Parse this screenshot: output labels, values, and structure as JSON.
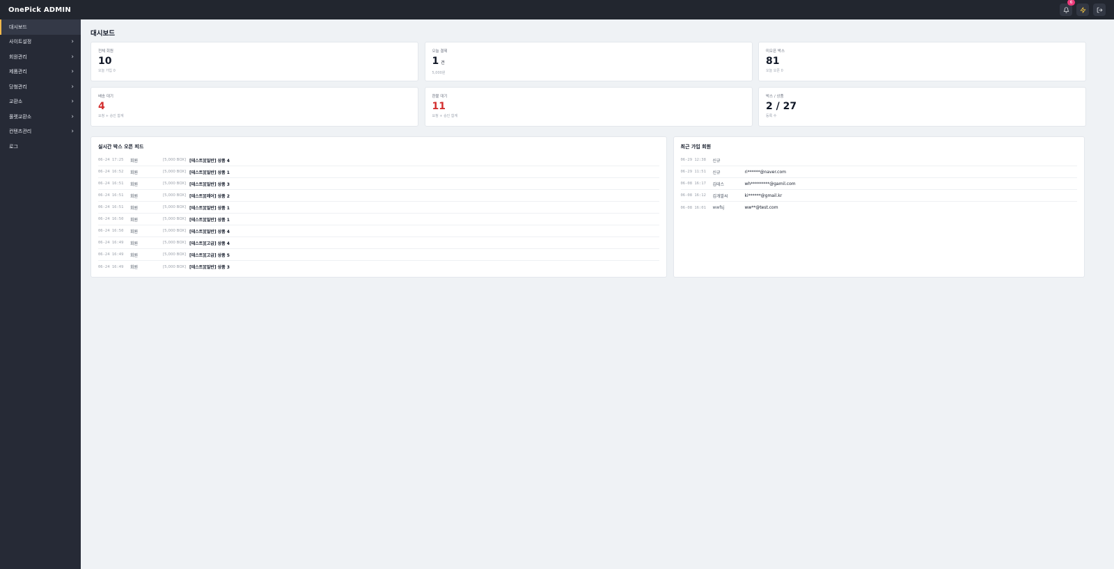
{
  "header": {
    "brand": "OnePick ADMIN",
    "notification_count": "6",
    "icons": [
      "bell-icon",
      "bolt-icon",
      "logout-icon"
    ]
  },
  "sidebar": {
    "items": [
      {
        "label": "대시보드",
        "active": true,
        "has_children": false
      },
      {
        "label": "사이트설정",
        "active": false,
        "has_children": true
      },
      {
        "label": "회원관리",
        "active": false,
        "has_children": true
      },
      {
        "label": "제품관리",
        "active": false,
        "has_children": true
      },
      {
        "label": "당첨관리",
        "active": false,
        "has_children": true
      },
      {
        "label": "교환소",
        "active": false,
        "has_children": true
      },
      {
        "label": "풀렛교환소",
        "active": false,
        "has_children": true
      },
      {
        "label": "컨텐츠관리",
        "active": false,
        "has_children": true
      },
      {
        "label": "로그",
        "active": false,
        "has_children": false
      }
    ]
  },
  "page": {
    "title": "대시보드"
  },
  "stats": [
    {
      "label": "전체 회원",
      "value": "10",
      "unit": "",
      "sub": "오늘 가입 0",
      "highlight": false
    },
    {
      "label": "오늘 결제",
      "value": "1",
      "unit": "건",
      "sub": "5,000원",
      "highlight": false
    },
    {
      "label": "미오픈 박스",
      "value": "81",
      "unit": "",
      "sub": "오늘 오픈 0",
      "highlight": false
    },
    {
      "label": "배송 대기",
      "value": "4",
      "unit": "",
      "sub": "요청 + 승인 합계",
      "highlight": true
    },
    {
      "label": "환불 대기",
      "value": "11",
      "unit": "",
      "sub": "요청 + 승인 합계",
      "highlight": true
    },
    {
      "label": "박스 / 상품",
      "value": "2 / 27",
      "unit": "",
      "sub": "등록 수",
      "highlight": false
    }
  ],
  "feed": {
    "title": "실시간 박스 오픈 피드",
    "rows": [
      {
        "time": "06-24 17:25",
        "who": "회원",
        "box": "[5,000 BOX]",
        "item": "[테스트][일반] 상품 4"
      },
      {
        "time": "06-24 16:52",
        "who": "회원",
        "box": "[5,000 BOX]",
        "item": "[테스트][일반] 상품 1"
      },
      {
        "time": "06-24 16:51",
        "who": "회원",
        "box": "[5,000 BOX]",
        "item": "[테스트][일반] 상품 3"
      },
      {
        "time": "06-24 16:51",
        "who": "회원",
        "box": "[5,000 BOX]",
        "item": "[테스트][레어] 상품 2"
      },
      {
        "time": "06-24 16:51",
        "who": "회원",
        "box": "[5,000 BOX]",
        "item": "[테스트][일반] 상품 1"
      },
      {
        "time": "06-24 16:50",
        "who": "회원",
        "box": "[5,000 BOX]",
        "item": "[테스트][일반] 상품 1"
      },
      {
        "time": "06-24 16:50",
        "who": "회원",
        "box": "[5,000 BOX]",
        "item": "[테스트][일반] 상품 4"
      },
      {
        "time": "06-24 16:49",
        "who": "회원",
        "box": "[5,000 BOX]",
        "item": "[테스트][고급] 상품 4"
      },
      {
        "time": "06-24 16:49",
        "who": "회원",
        "box": "[5,000 BOX]",
        "item": "[테스트][고급] 상품 5"
      },
      {
        "time": "06-24 16:49",
        "who": "회원",
        "box": "[5,000 BOX]",
        "item": "[테스트][일반] 상품 3"
      }
    ]
  },
  "members": {
    "title": "최근 가입 회원",
    "rows": [
      {
        "time": "06-29 12:38",
        "name": "신규",
        "email": ""
      },
      {
        "time": "06-29 11:51",
        "name": "신규",
        "email": "ri******@naver.com"
      },
      {
        "time": "06-08 16:17",
        "name": "김테스",
        "email": "wh*********@gamil.com"
      },
      {
        "time": "06-08 16:12",
        "name": "김개발씨",
        "email": "ki******@gmail.kr"
      },
      {
        "time": "06-08 16:01",
        "name": "wwfsj",
        "email": "ww**@test.com"
      }
    ]
  }
}
